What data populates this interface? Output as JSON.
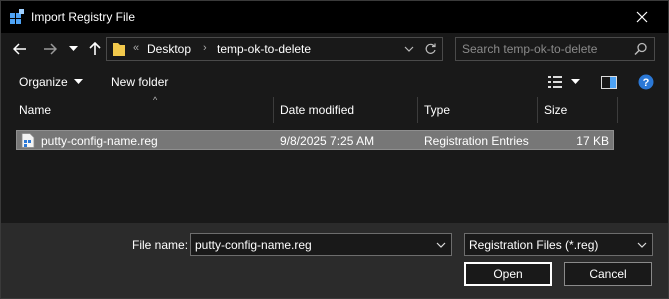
{
  "window": {
    "title": "Import Registry File",
    "close_glyph": "✕"
  },
  "nav": {
    "back_glyph": "←",
    "forward_glyph": "→",
    "recent_glyph": "⌄",
    "up_glyph": "↑"
  },
  "address": {
    "overflow": "«",
    "crumbs": [
      "Desktop",
      "temp-ok-to-delete"
    ],
    "separator": "›"
  },
  "search": {
    "placeholder": "Search temp-ok-to-delete"
  },
  "toolbar": {
    "organize_label": "Organize",
    "new_folder_label": "New folder"
  },
  "columns": {
    "name": "Name",
    "date_modified": "Date modified",
    "type": "Type",
    "size": "Size",
    "sort_glyph": "^"
  },
  "files": [
    {
      "name": "putty-config-name.reg",
      "date_modified": "9/8/2025 7:25 AM",
      "type": "Registration Entries",
      "size": "17 KB"
    }
  ],
  "footer": {
    "file_name_label": "File name:",
    "file_name_value": "putty-config-name.reg",
    "file_type_value": "Registration Files (*.reg)",
    "open_label": "Open",
    "cancel_label": "Cancel"
  },
  "colors": {
    "background": "#191919",
    "title_bar": "#000000",
    "selection": "#777777",
    "footer": "#2b2b2b",
    "help_icon": "#2b78d6",
    "folder": "#f2c94c"
  }
}
